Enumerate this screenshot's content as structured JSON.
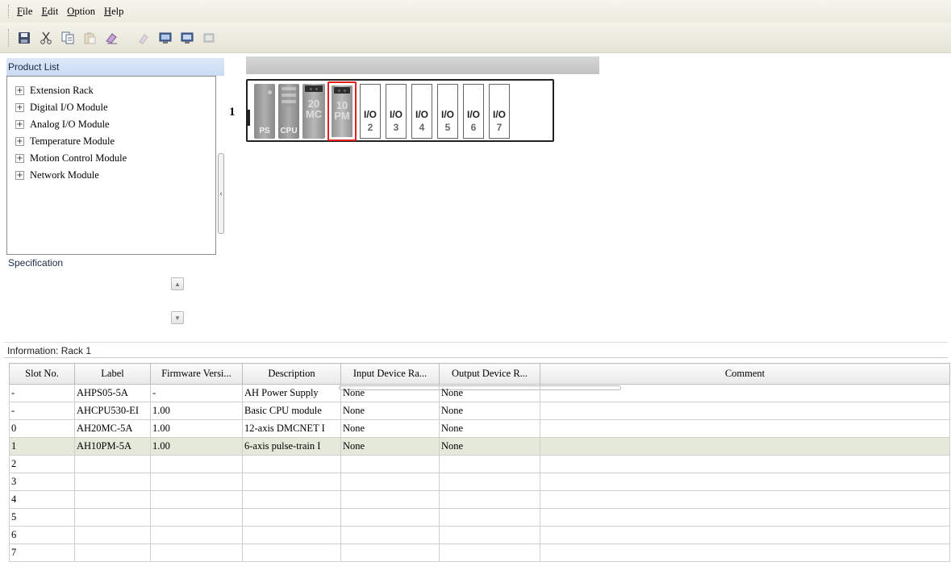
{
  "menu": {
    "file": "File",
    "edit": "Edit",
    "option": "Option",
    "help": "Help"
  },
  "toolbar": {
    "buttons": [
      "save-icon",
      "cut-icon",
      "copy-icon",
      "paste-icon",
      "delete-icon",
      "undo-icon",
      "upload-icon",
      "download-icon",
      "compare-icon"
    ]
  },
  "product_list": {
    "title": "Product List",
    "items": [
      {
        "label": "Extension Rack"
      },
      {
        "label": "Digital I/O Module"
      },
      {
        "label": "Analog I/O Module"
      },
      {
        "label": "Temperature Module"
      },
      {
        "label": "Motion Control Module"
      },
      {
        "label": "Network Module"
      }
    ],
    "expand_glyph": "+"
  },
  "specification": {
    "title": "Specification"
  },
  "rack": {
    "number": "1",
    "modules": [
      {
        "top": "",
        "label": "PS"
      },
      {
        "top": "",
        "label": "CPU"
      },
      {
        "top": "20\nMC",
        "label": ""
      },
      {
        "top": "10\nPM",
        "label": ""
      }
    ],
    "io_slots": [
      {
        "text": "I/O",
        "num": "2"
      },
      {
        "text": "I/O",
        "num": "3"
      },
      {
        "text": "I/O",
        "num": "4"
      },
      {
        "text": "I/O",
        "num": "5"
      },
      {
        "text": "I/O",
        "num": "6"
      },
      {
        "text": "I/O",
        "num": "7"
      }
    ],
    "selected_color": "#e0201c"
  },
  "info": {
    "title": "Information: Rack 1"
  },
  "grid": {
    "columns": [
      "Slot No.",
      "Label",
      "Firmware Versi...",
      "Description",
      "Input Device Ra...",
      "Output Device R...",
      "Comment"
    ],
    "rows": [
      [
        "-",
        "AHPS05-5A",
        "-",
        "AH Power Supply",
        "None",
        "None",
        ""
      ],
      [
        "-",
        "AHCPU530-EI",
        "1.00",
        "Basic CPU module",
        "None",
        "None",
        ""
      ],
      [
        "0",
        "AH20MC-5A",
        "1.00",
        "12-axis DMCNET I",
        "None",
        "None",
        ""
      ],
      [
        "1",
        "AH10PM-5A",
        "1.00",
        "6-axis pulse-train I",
        "None",
        "None",
        ""
      ],
      [
        "2",
        "",
        "",
        "",
        "",
        "",
        ""
      ],
      [
        "3",
        "",
        "",
        "",
        "",
        "",
        ""
      ],
      [
        "4",
        "",
        "",
        "",
        "",
        "",
        ""
      ],
      [
        "5",
        "",
        "",
        "",
        "",
        "",
        ""
      ],
      [
        "6",
        "",
        "",
        "",
        "",
        "",
        ""
      ],
      [
        "7",
        "",
        "",
        "",
        "",
        "",
        ""
      ]
    ],
    "selected_row": 3
  }
}
